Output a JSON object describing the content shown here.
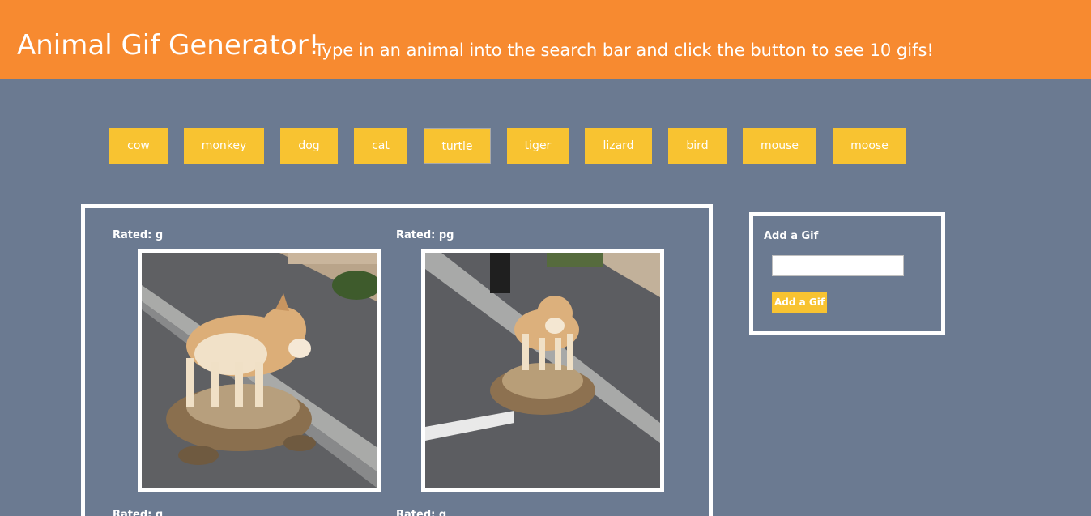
{
  "header": {
    "title": "Animal Gif Generator!",
    "subtitle": "Type in an animal into the search bar and click the button to see 10 gifs!"
  },
  "animals": [
    "cow",
    "monkey",
    "dog",
    "cat",
    "turtle",
    "tiger",
    "lizard",
    "bird",
    "mouse",
    "moose"
  ],
  "active_animal": "turtle",
  "gifs": [
    {
      "rating": "Rated: g"
    },
    {
      "rating": "Rated: pg"
    },
    {
      "rating": "Rated: g"
    },
    {
      "rating": "Rated: g"
    }
  ],
  "add_form": {
    "label": "Add a Gif",
    "input_value": "",
    "button_label": "Add a Gif"
  },
  "colors": {
    "header": "#f78a30",
    "background": "#6b7a91",
    "button": "#f8c331"
  }
}
